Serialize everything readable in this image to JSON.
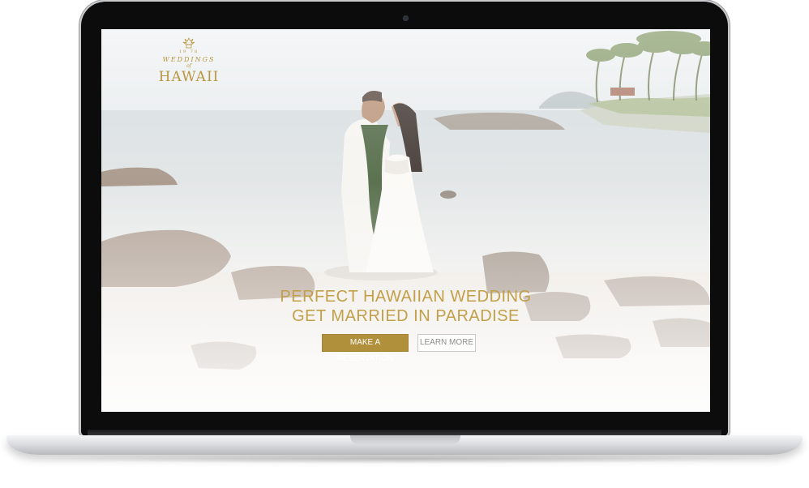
{
  "site": {
    "logo": {
      "icon": "pineapple-icon",
      "est": "19 78",
      "line1": "WEDDINGS",
      "of": "of",
      "line2": "HAWAII"
    },
    "hero": {
      "headline_1": "PERFECT HAWAIIAN WEDDING",
      "headline_2": "GET MARRIED IN PARADISE",
      "primary_button": "MAKE A RESERVATION",
      "secondary_button": "LEARN MORE"
    }
  },
  "colors": {
    "gold": "#b0903a",
    "headline_gold": "#c2a04a",
    "laptop_bezel": "#0c0c0d",
    "laptop_silver": "#dcdde0"
  }
}
